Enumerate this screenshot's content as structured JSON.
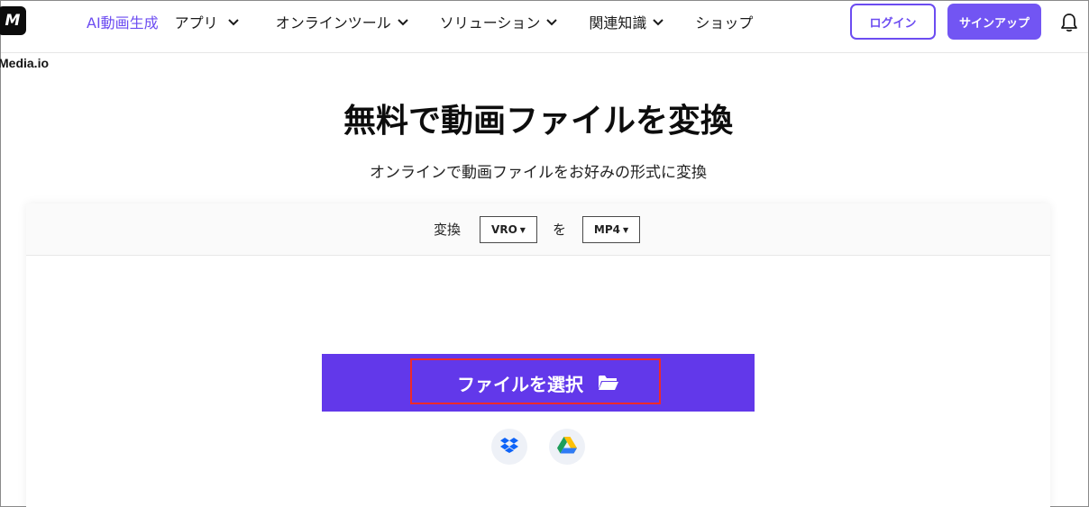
{
  "brand": {
    "logo_text": "M",
    "name": "Media.io"
  },
  "nav": {
    "items": [
      {
        "label": "AI動画生成",
        "active": true,
        "has_dropdown": false
      },
      {
        "label": "アプリ",
        "active": false,
        "has_dropdown": true
      },
      {
        "label": "オンラインツール",
        "active": false,
        "has_dropdown": true
      },
      {
        "label": "ソリューション",
        "active": false,
        "has_dropdown": true
      },
      {
        "label": "関連知識",
        "active": false,
        "has_dropdown": true
      },
      {
        "label": "ショップ",
        "active": false,
        "has_dropdown": false
      }
    ],
    "login_label": "ログイン",
    "signup_label": "サインアップ"
  },
  "hero": {
    "title": "無料で動画ファイルを変換",
    "subtitle": "オンラインで動画ファイルをお好みの形式に変換"
  },
  "converter": {
    "convert_label": "変換",
    "to_label": "を",
    "from_format": "VRO",
    "to_format": "MP4",
    "choose_file_label": "ファイルを選択",
    "cloud_sources": [
      "dropbox-icon",
      "google-drive-icon"
    ]
  },
  "colors": {
    "accent": "#6c4cf1",
    "primary_button": "#6238ea",
    "highlight_border": "#ef2a2a"
  }
}
